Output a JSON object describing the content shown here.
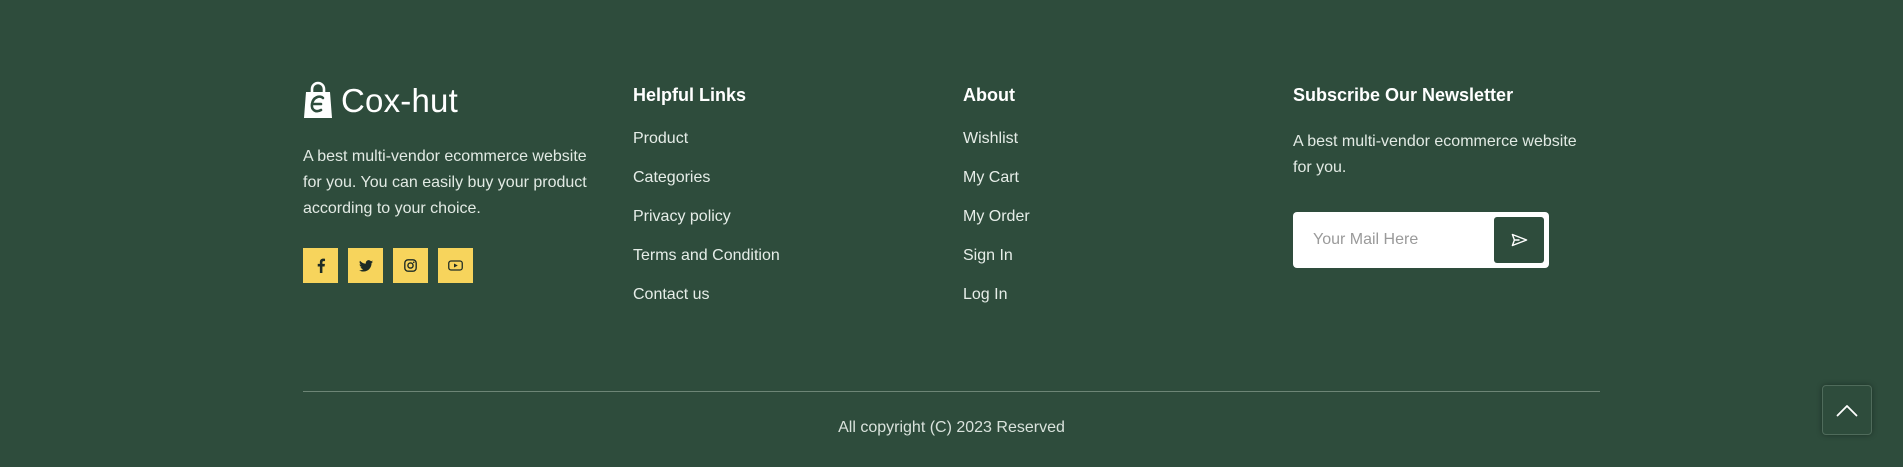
{
  "brand": {
    "name": "Cox-hut",
    "logo_icon": "shopping-bag-e-icon",
    "description": "A best multi-vendor ecommerce website for you. You can easily buy your product according to your choice."
  },
  "socials": [
    {
      "name": "facebook",
      "icon": "facebook-icon"
    },
    {
      "name": "twitter",
      "icon": "twitter-icon"
    },
    {
      "name": "instagram",
      "icon": "instagram-icon"
    },
    {
      "name": "youtube",
      "icon": "youtube-icon"
    }
  ],
  "helpful_links": {
    "title": "Helpful Links",
    "items": [
      "Product",
      "Categories",
      "Privacy policy",
      "Terms and Condition",
      "Contact us"
    ]
  },
  "about": {
    "title": "About",
    "items": [
      "Wishlist",
      "My Cart",
      "My Order",
      "Sign In",
      "Log In"
    ]
  },
  "newsletter": {
    "title": "Subscribe Our Newsletter",
    "description": "A best multi-vendor ecommerce website for you.",
    "input_placeholder": "Your Mail Here",
    "input_value": "",
    "send_icon": "send-icon"
  },
  "copyright": "All copyright (C) 2023 Reserved",
  "scroll_top_icon": "chevron-up-icon",
  "colors": {
    "background": "#2e4c3c",
    "accent_yellow": "#f7d45c",
    "text": "#ffffff"
  }
}
